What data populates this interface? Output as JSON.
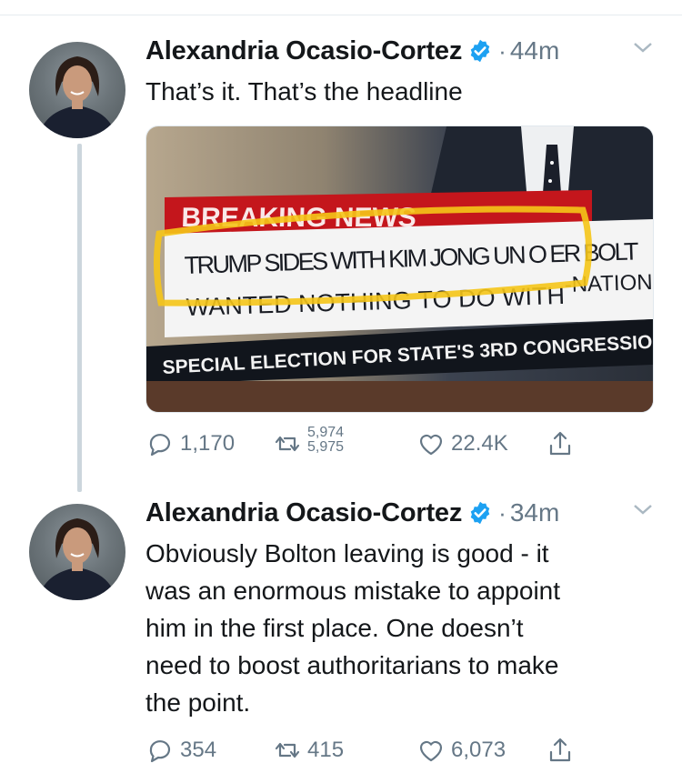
{
  "tweets": [
    {
      "author": "Alexandria Ocasio-Cortez",
      "time": "44m",
      "text": "That’s it. That’s the headline",
      "media": {
        "line1": "BREAKING NEWS",
        "headline": "TRUMP SIDES WITH KIM JONG UN O  ER BOLT",
        "line3_left": "WANTED  NOTHING TO DO WITH",
        "line3_right": "-NATION",
        "ticker": "SPECIAL ELECTION FOR STATE'S 3RD CONGRESSION"
      },
      "replies": "1,170",
      "retweets_top": "5,974",
      "retweets_bottom": "5,975",
      "likes": "22.4K"
    },
    {
      "author": "Alexandria Ocasio-Cortez",
      "time": "34m",
      "text_lines": [
        "Obviously Bolton leaving is good - it",
        "was an enormous mistake to appoint",
        "him in the first place. One doesn’t",
        "need to boost authoritarians to make",
        "the point."
      ],
      "replies": "354",
      "retweets": "415",
      "likes": "6,073"
    }
  ],
  "colors": {
    "verified": "#1da1f2",
    "muted": "#657786",
    "highlight": "#f5c518"
  },
  "icons": [
    "reply-icon",
    "retweet-icon",
    "like-icon",
    "share-icon",
    "verified-badge-icon",
    "chevron-down-icon"
  ]
}
